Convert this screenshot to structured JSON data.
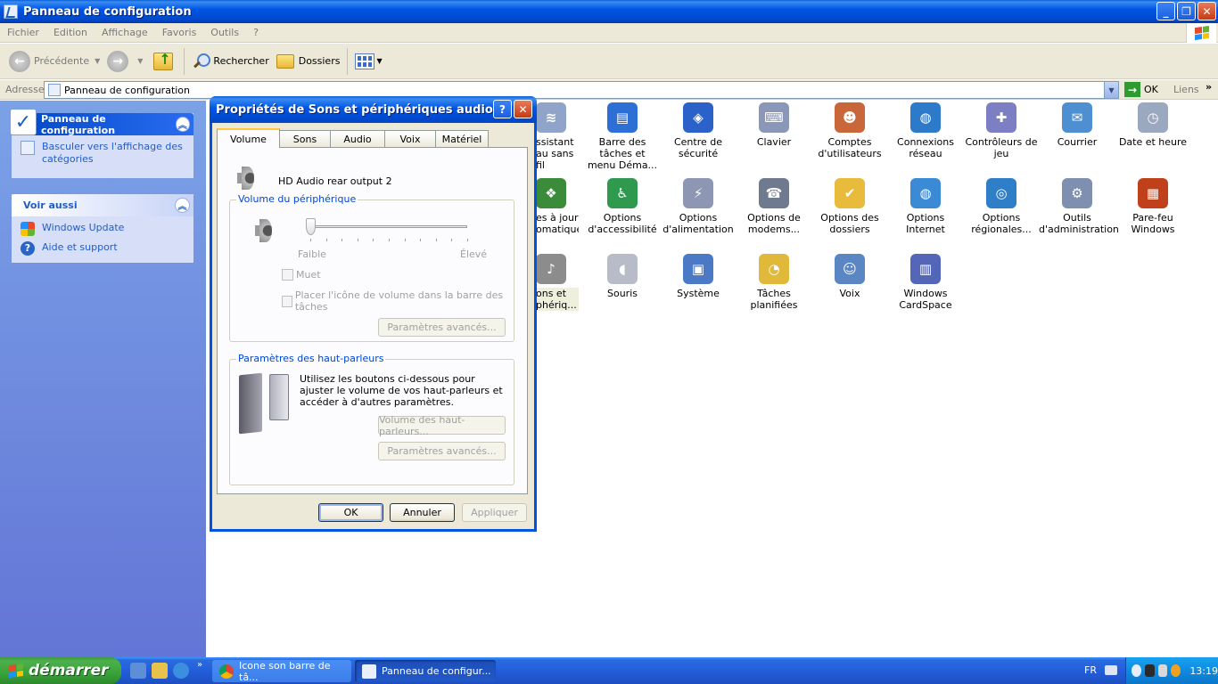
{
  "window": {
    "title": "Panneau de configuration"
  },
  "menu": [
    "Fichier",
    "Edition",
    "Affichage",
    "Favoris",
    "Outils",
    "?"
  ],
  "toolbar": {
    "back": "Précédente",
    "search": "Rechercher",
    "folders": "Dossiers"
  },
  "address": {
    "label": "Adresse",
    "value": "Panneau de configuration",
    "go": "OK",
    "links": "Liens"
  },
  "sidebar": {
    "panel1": {
      "title": "Panneau de configuration",
      "link": "Basculer vers l'affichage des catégories"
    },
    "panel2": {
      "title": "Voir aussi",
      "links": [
        "Windows Update",
        "Aide et support"
      ]
    }
  },
  "icons": [
    {
      "label": "Assistant réseau sans fil",
      "shown": "ssistant\nau sans fil",
      "icon": "wireless-icon",
      "color": "#8fa4c8"
    },
    {
      "label": "Barre des tâches et menu Déma...",
      "icon": "taskbar-icon",
      "color": "#2e6fd6"
    },
    {
      "label": "Centre de sécurité",
      "icon": "security-shield-icon",
      "color": "#2a62c9"
    },
    {
      "label": "Clavier",
      "icon": "keyboard-icon",
      "color": "#8b97b8"
    },
    {
      "label": "Comptes d'utilisateurs",
      "icon": "users-icon",
      "color": "#c9663a"
    },
    {
      "label": "Connexions réseau",
      "icon": "network-globe-icon",
      "color": "#2c7ac9"
    },
    {
      "label": "Contrôleurs de jeu",
      "icon": "gamepad-icon",
      "color": "#7d7fc4"
    },
    {
      "label": "Courrier",
      "icon": "mail-icon",
      "color": "#4d8fd0"
    },
    {
      "label": "Date et heure",
      "icon": "clock-icon",
      "color": "#9aa8c0"
    },
    {
      "label": "Mises à jour automatiques",
      "shown": "es à jour\nomatiques",
      "icon": "windows-update-icon",
      "color": "#3a8c3a"
    },
    {
      "label": "Options d'accessibilité",
      "icon": "accessibility-icon",
      "color": "#2f9a4e"
    },
    {
      "label": "Options d'alimentation",
      "icon": "power-icon",
      "color": "#8d96b2"
    },
    {
      "label": "Options de modems...",
      "icon": "modem-icon",
      "color": "#6f7a8f"
    },
    {
      "label": "Options des dossiers",
      "icon": "folder-options-icon",
      "color": "#e8bb3c"
    },
    {
      "label": "Options Internet",
      "icon": "internet-icon",
      "color": "#3b8ad6"
    },
    {
      "label": "Options régionales...",
      "icon": "globe-icon",
      "color": "#2f7ec8"
    },
    {
      "label": "Outils d'administration",
      "icon": "admin-tools-icon",
      "color": "#7f8fb0"
    },
    {
      "label": "Pare-feu Windows",
      "icon": "firewall-icon",
      "color": "#c0401c"
    },
    {
      "label": "Sons et périphériques audio",
      "shown": "ons et\nphériq...",
      "icon": "speaker-icon",
      "color": "#8c8c8c"
    },
    {
      "label": "Souris",
      "icon": "mouse-icon",
      "color": "#b8bcc8"
    },
    {
      "label": "Système",
      "icon": "system-icon",
      "color": "#4c79c6"
    },
    {
      "label": "Tâches planifiées",
      "icon": "scheduled-tasks-icon",
      "color": "#e0b83a"
    },
    {
      "label": "Voix",
      "icon": "speech-icon",
      "color": "#5a86c4"
    },
    {
      "label": "Windows CardSpace",
      "icon": "cardspace-icon",
      "color": "#5466b8"
    }
  ],
  "dialog": {
    "title": "Propriétés de Sons et périphériques audio",
    "tabs": [
      "Volume",
      "Sons",
      "Audio",
      "Voix",
      "Matériel"
    ],
    "device": "HD Audio rear output 2",
    "volume_group": "Volume du périphérique",
    "slider_min": "Faible",
    "slider_max": "Élevé",
    "volume_level": 0,
    "mute": "Muet",
    "tray_icon": "Placer l'icône de volume dans la barre des tâches",
    "advanced1": "Paramètres avancés...",
    "speakers_group": "Paramètres des haut-parleurs",
    "speakers_text": "Utilisez les boutons ci-dessous pour ajuster le volume de vos haut-parleurs et accéder à d'autres paramètres.",
    "speaker_volume": "Volume des haut-parleurs...",
    "advanced2": "Paramètres avancés...",
    "ok": "OK",
    "cancel": "Annuler",
    "apply": "Appliquer"
  },
  "taskbar": {
    "start": "démarrer",
    "tasks": [
      "Icone son barre de tâ...",
      "Panneau de configur..."
    ],
    "lang": "FR",
    "clock": "13:19"
  }
}
